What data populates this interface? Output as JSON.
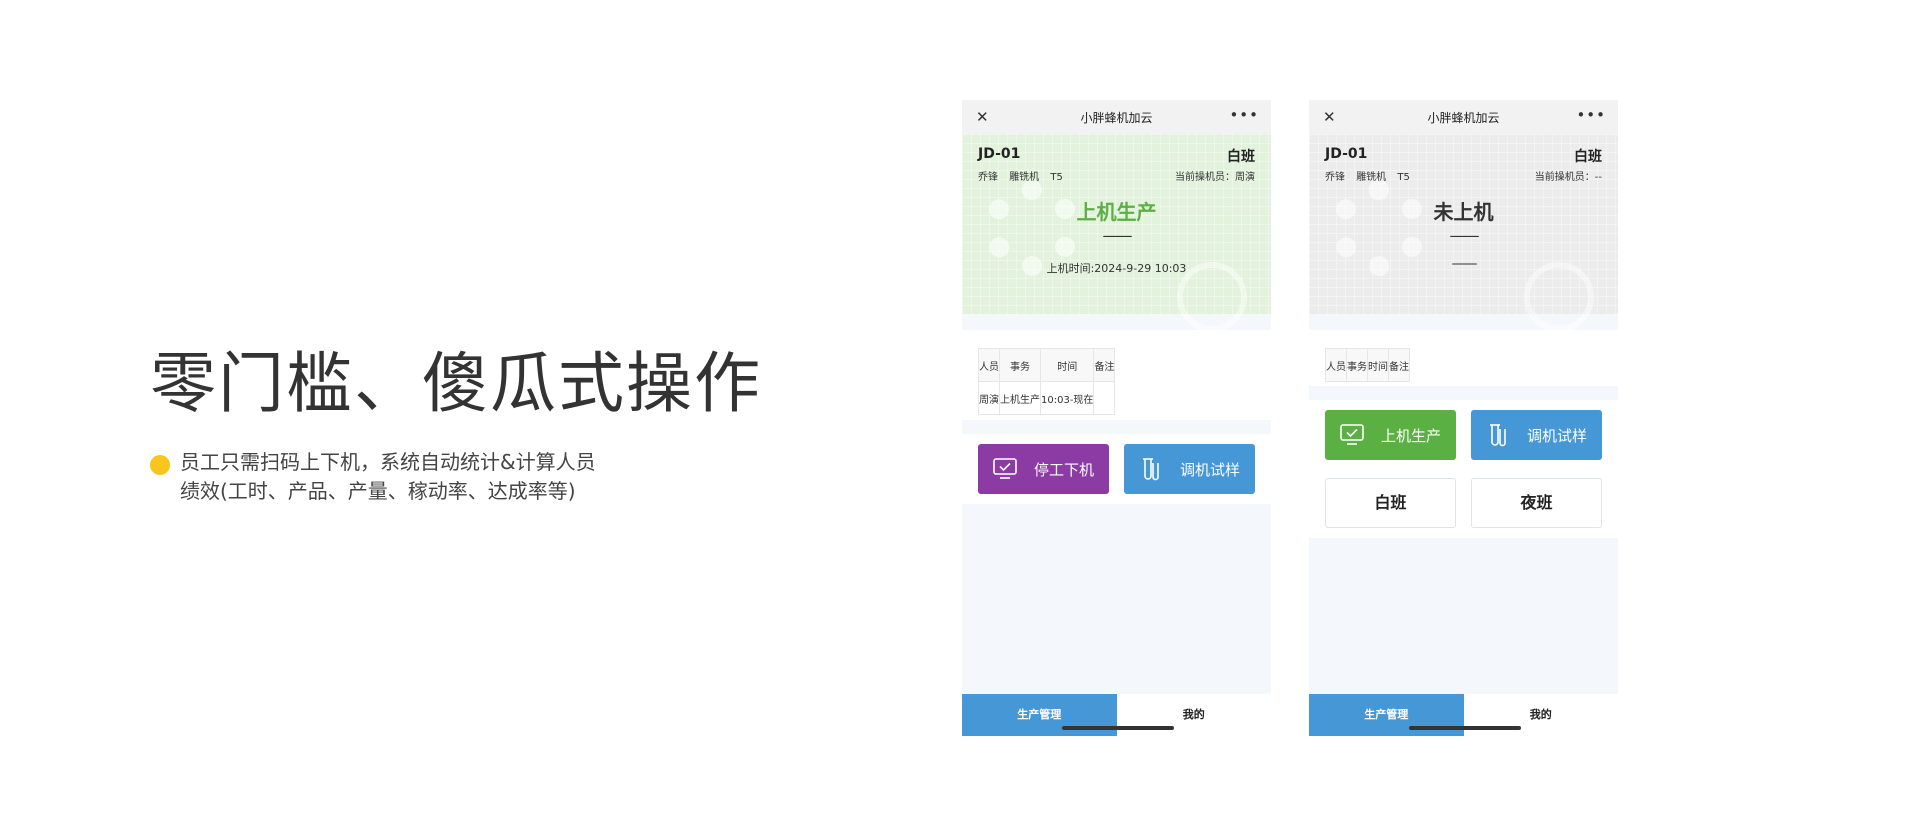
{
  "slide": {
    "headline": "零门槛、傻瓜式操作",
    "bullet_line1": "员工只需扫码上下机，系统自动统计&计算人员",
    "bullet_line2": "绩效(工时、产品、产量、稼动率、达成率等)",
    "accent_color": "#f8c51d"
  },
  "phone1": {
    "app_title": "小胖蜂机加云",
    "machine_code": "JD-01",
    "shift": "白班",
    "meta": [
      "乔锋",
      "雕铣机",
      "T5"
    ],
    "operator": "当前操机员：周演",
    "status": "上机生产",
    "status_color": "#5bb043",
    "dash": "——",
    "start_time": "上机时间:2024-9-29 10:03",
    "table": {
      "headers": [
        "人员",
        "事务",
        "时间",
        "备注"
      ],
      "rows": [
        [
          "周演",
          "上机生产",
          "10:03-现在",
          ""
        ]
      ]
    },
    "buttons": {
      "stop": "停工下机",
      "debug": "调机试样"
    },
    "tabs": [
      "生产管理",
      "我的"
    ]
  },
  "phone2": {
    "app_title": "小胖蜂机加云",
    "machine_code": "JD-01",
    "shift": "白班",
    "meta": [
      "乔锋",
      "雕铣机",
      "T5"
    ],
    "operator": "当前操机员：--",
    "status": "未上机",
    "dash": "——",
    "dash2": "——",
    "table": {
      "headers": [
        "人员",
        "事务",
        "时间",
        "备注"
      ]
    },
    "buttons": {
      "start": "上机生产",
      "debug": "调机试样",
      "day": "白班",
      "night": "夜班"
    },
    "tabs": [
      "生产管理",
      "我的"
    ]
  },
  "colors": {
    "purple": "#8c3ba5",
    "blue": "#4597d6",
    "green": "#5bb043"
  },
  "icons": {
    "close": "close-icon",
    "more": "more-icon",
    "monitor": "monitor-check-icon",
    "test_tube": "test-tube-icon"
  }
}
